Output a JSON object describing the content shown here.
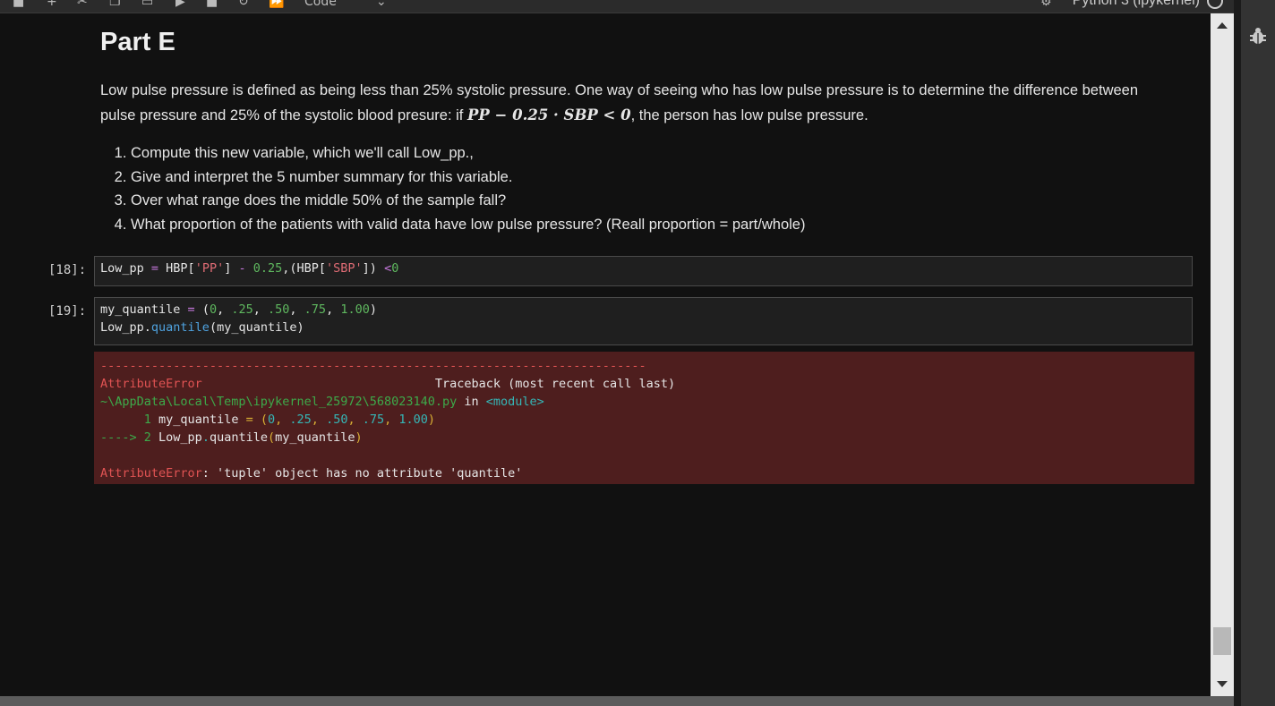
{
  "toolbar": {
    "cell_type": "Code",
    "kernel": "Python 3 (ipykernel)"
  },
  "markdown": {
    "heading": "Part E",
    "paragraph_before": "Low pulse pressure is defined as being less than 25% systolic pressure. One way of seeing who has low pulse pressure is to determine the difference between pulse pressure and 25% of the systolic blood presure: if ",
    "math": "PP − 0.25 · SBP < 0",
    "paragraph_after": ", the person has low pulse pressure.",
    "list": [
      "Compute this new variable, which we'll call Low_pp.,",
      "Give and interpret the 5 number summary for this variable.",
      "Over what range does the middle 50% of the sample fall?",
      "What proportion of the patients with valid data have low pulse pressure? (Reall proportion = part/whole)"
    ]
  },
  "cells": [
    {
      "prompt": "[18]:"
    },
    {
      "prompt": "[19]:"
    }
  ],
  "code18": {
    "var": "Low_pp ",
    "eq": "=",
    "hbp1": " HBP[",
    "str1": "'PP'",
    "close1": "] ",
    "minus": "-",
    "num1": " 0.25",
    "rest1": ",(HBP[",
    "str2": "'SBP'",
    "close2": "]) ",
    "lt": "<",
    "num2": "0"
  },
  "code19": {
    "l1_var": "my_quantile ",
    "l1_eq": "=",
    "l1_open": " (",
    "l1_n1": "0",
    "l1_c1": ", ",
    "l1_n2": ".25",
    "l1_c2": ", ",
    "l1_n3": ".50",
    "l1_c3": ", ",
    "l1_n4": ".75",
    "l1_c4": ", ",
    "l1_n5": "1.00",
    "l1_close": ")",
    "l2_obj": "Low_pp.",
    "l2_fn": "quantile",
    "l2_args": "(my_quantile)"
  },
  "error": {
    "dashes": "---------------------------------------------------------------------------",
    "name": "AttributeError",
    "pad": "                                ",
    "traceback": "Traceback (most recent call last)",
    "path": "~\\AppData\\Local\\Temp\\ipykernel_25972\\568023140.py",
    "in": " in ",
    "module": "<module>",
    "l1_indent": "      ",
    "l1_num": "1",
    "l1_var": " my_quantile ",
    "l1_eq": "=",
    "l1_open": " (",
    "l1_n1": "0",
    "l1_c1": ", ",
    "l1_n2": ".25",
    "l1_c2": ", ",
    "l1_n3": ".50",
    "l1_c3": ", ",
    "l1_n4": ".75",
    "l1_c4": ", ",
    "l1_n5": "1.00",
    "l1_close": ")",
    "l2_arrow": "----> 2",
    "l2_obj": " Low_pp",
    "l2_dot": ".",
    "l2_fn": "quantile",
    "l2_open": "(",
    "l2_arg": "my_quantile",
    "l2_close": ")",
    "final_name": "AttributeError",
    "final_msg": ": 'tuple' object has no attribute 'quantile'"
  },
  "colors": {
    "background": "#111111",
    "error_background": "#4e1e1e",
    "code_background": "#1f1f1f"
  }
}
